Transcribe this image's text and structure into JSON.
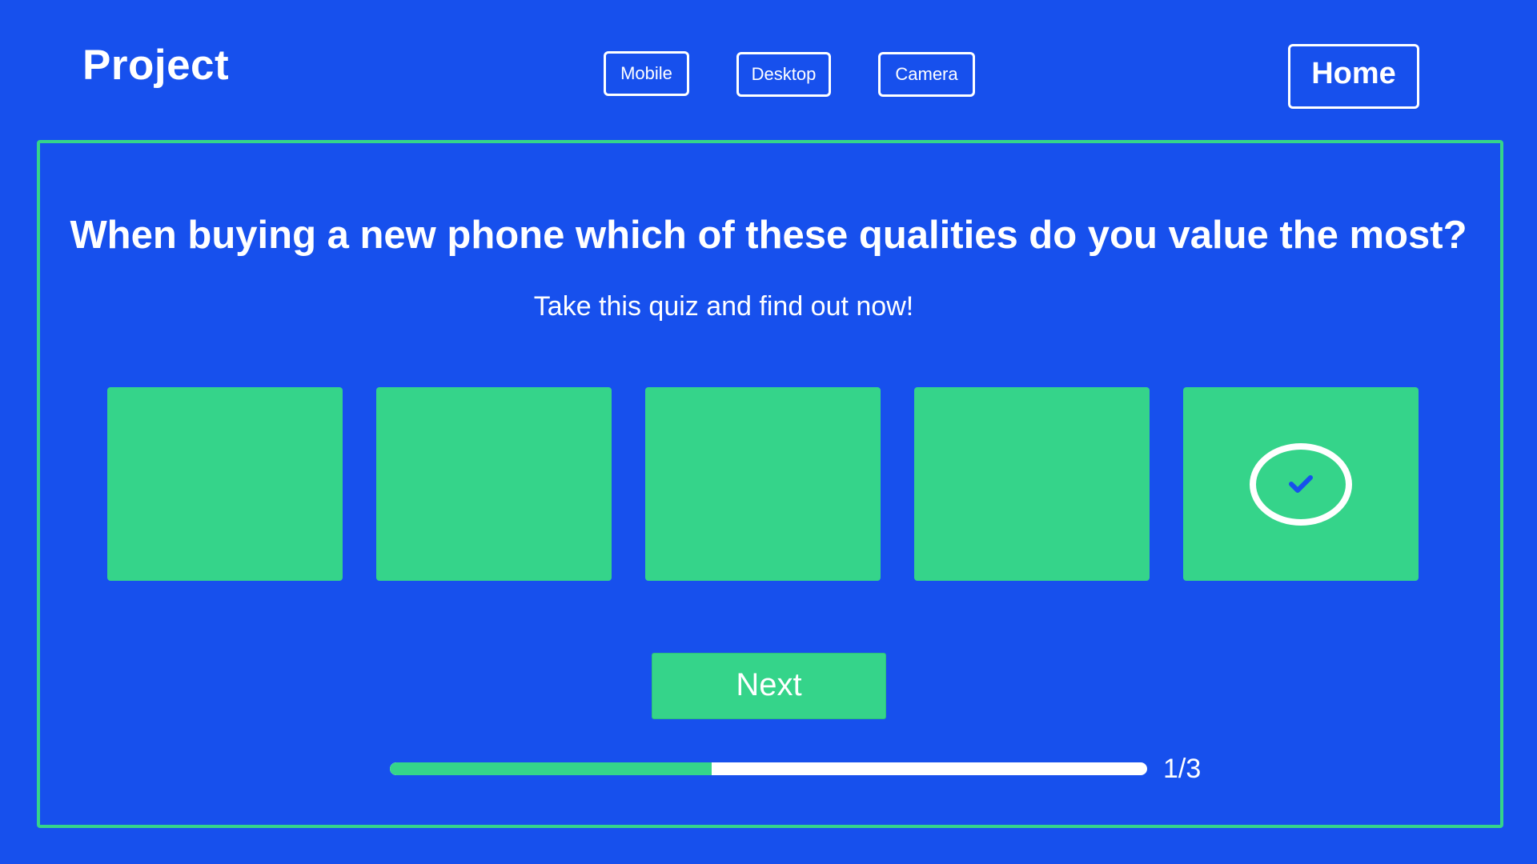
{
  "header": {
    "brand": "Project",
    "nav": [
      {
        "label": "Mobile"
      },
      {
        "label": "Desktop"
      },
      {
        "label": "Camera"
      }
    ],
    "home_label": "Home"
  },
  "quiz": {
    "question": "When buying a new phone which of these qualities do you value the most?",
    "subtitle": "Take this quiz and find out now!",
    "options": [
      {
        "selected": false
      },
      {
        "selected": false
      },
      {
        "selected": false
      },
      {
        "selected": false
      },
      {
        "selected": true,
        "icon": "check-circle-icon"
      }
    ],
    "next_label": "Next",
    "progress": {
      "fraction": 0.425,
      "label": "1/3"
    }
  },
  "colors": {
    "background": "#1750ed",
    "accent": "#35d48a",
    "text": "#ffffff"
  }
}
